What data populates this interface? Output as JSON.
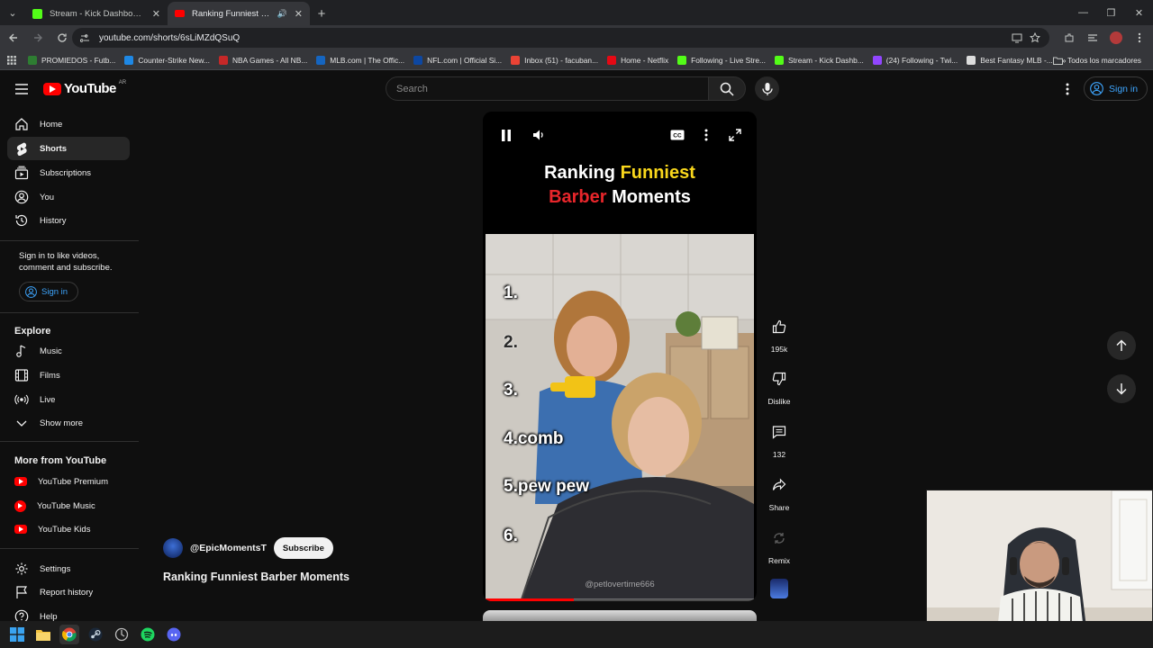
{
  "browser": {
    "tabs": [
      {
        "title": "Stream - Kick Dashboard",
        "active": false
      },
      {
        "title": "Ranking Funniest Barber M",
        "active": true
      }
    ],
    "url": "youtube.com/shorts/6sLiMZdQSuQ",
    "bookmarks": [
      {
        "label": "PROMIEDOS - Futb...",
        "color": "#2e7d32"
      },
      {
        "label": "Counter-Strike New...",
        "color": "#1e88e5"
      },
      {
        "label": "NBA Games - All NB...",
        "color": "#c62828"
      },
      {
        "label": "MLB.com | The Offic...",
        "color": "#1565c0"
      },
      {
        "label": "NFL.com | Official Si...",
        "color": "#0d47a1"
      },
      {
        "label": "Inbox (51) - facuban...",
        "color": "#ea4335"
      },
      {
        "label": "Home - Netflix",
        "color": "#e50914"
      },
      {
        "label": "Following - Live Stre...",
        "color": "#53fc18"
      },
      {
        "label": "Stream - Kick Dashb...",
        "color": "#53fc18"
      },
      {
        "label": "(24) Following - Twi...",
        "color": "#9146ff"
      },
      {
        "label": "Best Fantasy MLB -...",
        "color": "#dddddd"
      }
    ],
    "all_bookmarks_label": "Todos los marcadores"
  },
  "header": {
    "logo_text": "YouTube",
    "country_code": "AR",
    "search_placeholder": "Search",
    "signin_label": "Sign in"
  },
  "sidebar": {
    "main": [
      {
        "label": "Home",
        "icon": "home-icon"
      },
      {
        "label": "Shorts",
        "icon": "shorts-icon",
        "active": true
      },
      {
        "label": "Subscriptions",
        "icon": "subscriptions-icon"
      },
      {
        "label": "You",
        "icon": "you-icon"
      },
      {
        "label": "History",
        "icon": "history-icon"
      }
    ],
    "signin_prompt": "Sign in to like videos, comment and subscribe.",
    "signin_label": "Sign in",
    "explore_heading": "Explore",
    "explore": [
      {
        "label": "Music",
        "icon": "music-icon"
      },
      {
        "label": "Films",
        "icon": "films-icon"
      },
      {
        "label": "Live",
        "icon": "live-icon"
      },
      {
        "label": "Show more",
        "icon": "chevron-down-icon"
      }
    ],
    "more_heading": "More from YouTube",
    "more": [
      {
        "label": "YouTube Premium"
      },
      {
        "label": "YouTube Music"
      },
      {
        "label": "YouTube Kids"
      }
    ],
    "footer": [
      {
        "label": "Settings",
        "icon": "settings-icon"
      },
      {
        "label": "Report history",
        "icon": "flag-icon"
      },
      {
        "label": "Help",
        "icon": "help-icon"
      }
    ]
  },
  "short": {
    "title_words": {
      "w1": "Ranking",
      "w2": "Funniest",
      "w3": "Barber",
      "w4": "Moments"
    },
    "ranks": [
      "1.",
      "2.",
      "3.",
      "4.comb",
      "5.pew pew",
      "6."
    ],
    "watermark": "@petlovertime666",
    "progress": 0.33,
    "channel": "@EpicMomentsT",
    "subscribe_label": "Subscribe",
    "title": "Ranking Funniest Barber Moments"
  },
  "actions": {
    "like_count": "195k",
    "dislike_label": "Dislike",
    "comment_count": "132",
    "share_label": "Share",
    "remix_label": "Remix"
  },
  "colors": {
    "accent_red": "#ff0000",
    "link_blue": "#3ea6ff",
    "title_yellow": "#f9d71c",
    "title_red": "#e8262b"
  }
}
